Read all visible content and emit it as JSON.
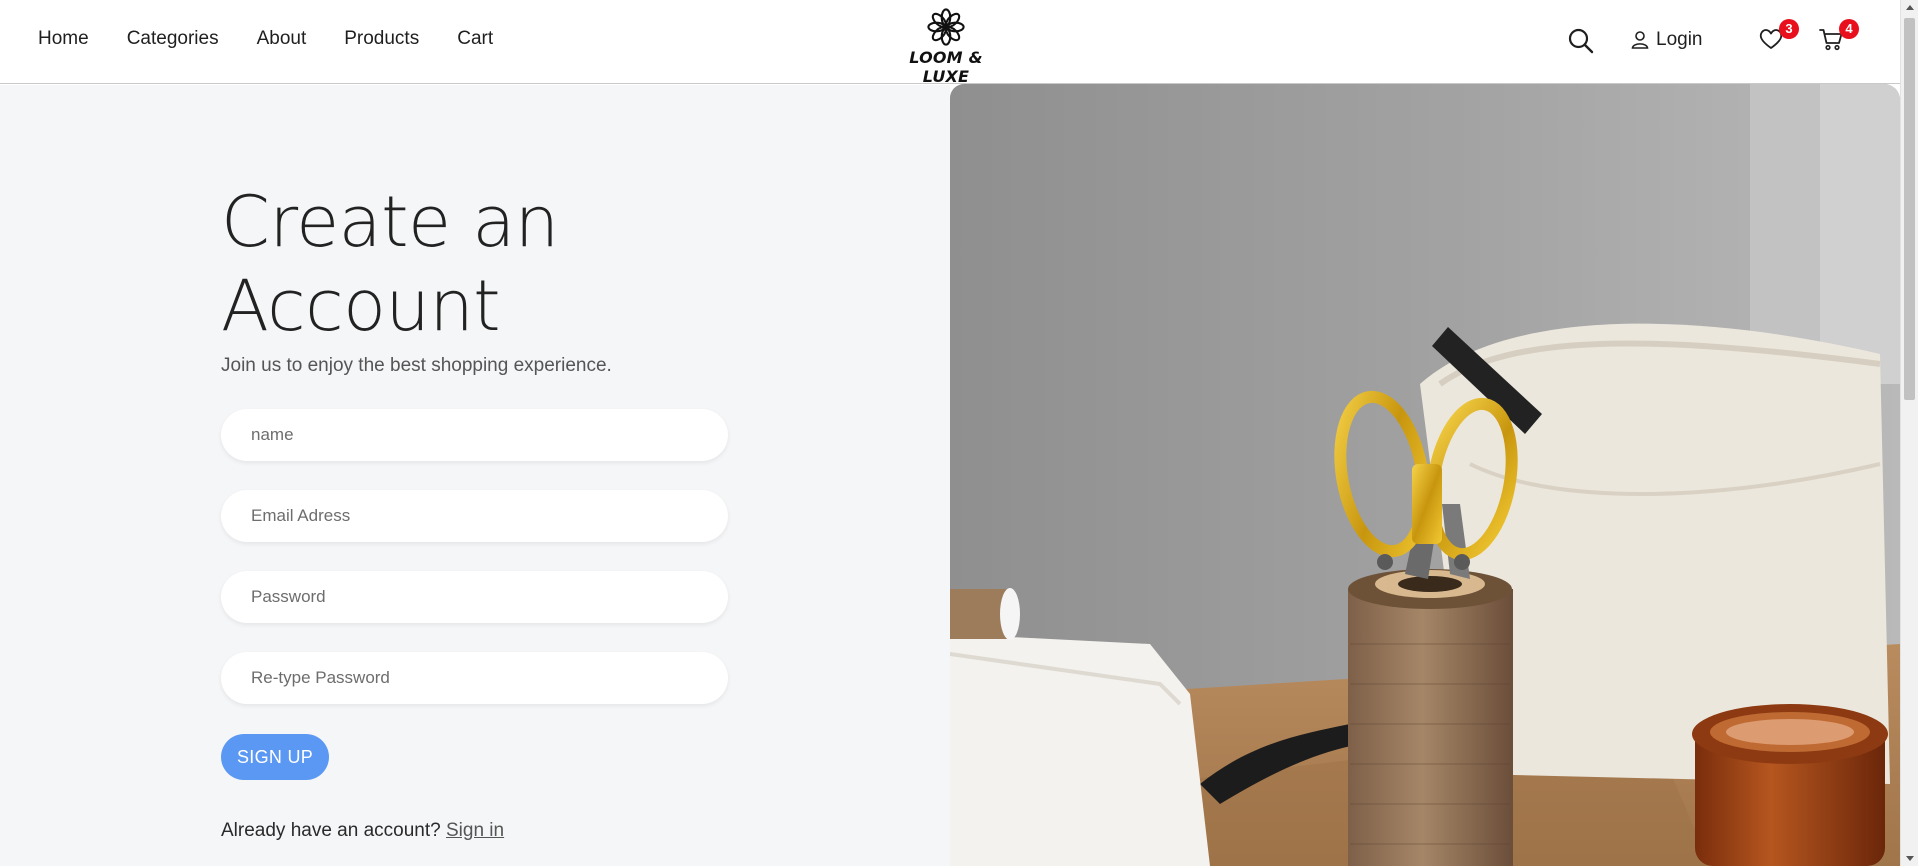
{
  "header": {
    "nav": [
      "Home",
      "Categories",
      "About",
      "Products",
      "Cart"
    ],
    "logo_text": "LOOM & LUXE",
    "login_label": "Login",
    "wishlist_count": "3",
    "cart_count": "4"
  },
  "signup": {
    "title": "Create an Account",
    "subtitle": "Join us to enjoy the best shopping experience.",
    "fields": {
      "name_placeholder": "name",
      "email_placeholder": "Email Adress",
      "password_placeholder": "Password",
      "retype_placeholder": "Re-type Password"
    },
    "button_label": "SIGN UP",
    "already_text": "Already have an account?",
    "signin_link": "Sign in"
  },
  "colors": {
    "accent": "#5b98f3",
    "badge": "#e8101c",
    "panel_bg": "#f5f6f8"
  },
  "icons": [
    "search-icon",
    "user-icon",
    "heart-icon",
    "cart-icon",
    "flower-logo-icon"
  ]
}
